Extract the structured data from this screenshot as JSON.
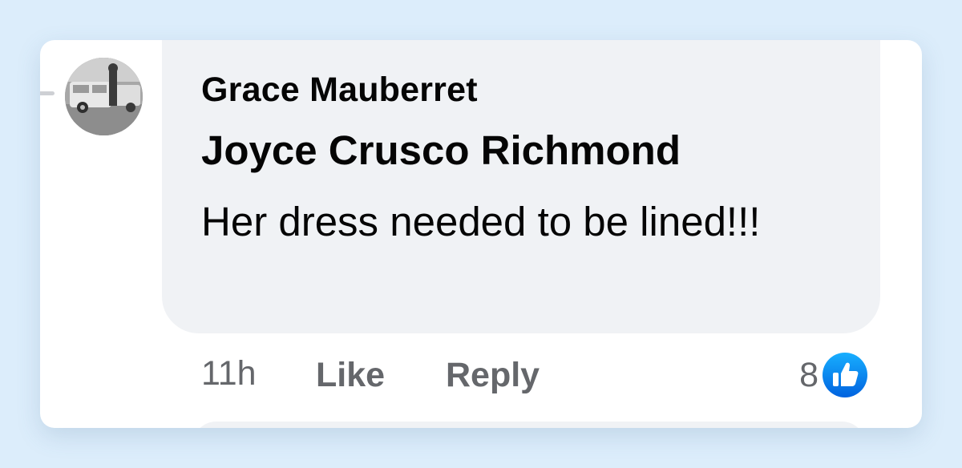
{
  "comment": {
    "author": "Grace Mauberret",
    "tagged_name": "Joyce Crusco Richmond",
    "text": "Her dress needed to be lined!!!",
    "time": "11h",
    "like_label": "Like",
    "reply_label": "Reply",
    "reaction_count": "8",
    "reaction_icon": "like-thumbs-up-icon"
  },
  "colors": {
    "page_background": "#dcedfb",
    "bubble": "#f0f2f5",
    "text_primary": "#050505",
    "text_secondary": "#65676b",
    "like_blue": "#1877f2"
  }
}
